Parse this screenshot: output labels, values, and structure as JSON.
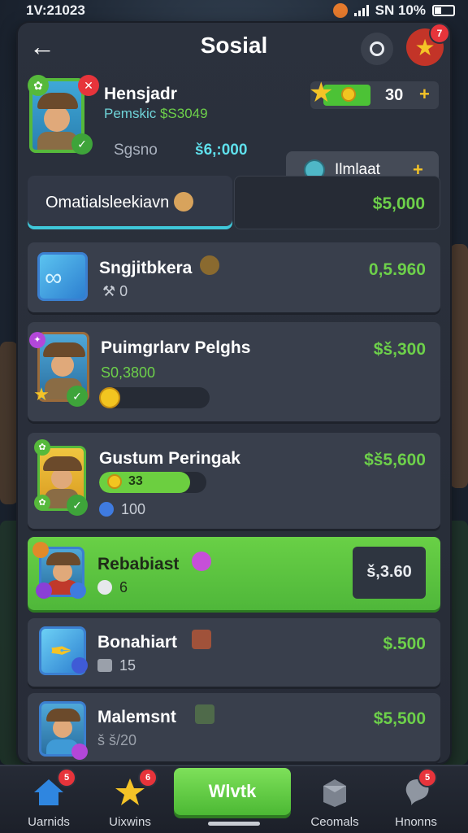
{
  "status_bar": {
    "time": "1V:21023",
    "right_text": "SN 10%"
  },
  "header": {
    "title": "Sosial",
    "notification_count": "7"
  },
  "profile": {
    "name": "Hensjadr",
    "subtitle_prefix": "Pemskic",
    "subtitle_money": "$S3049",
    "stat_label": "Sgsno",
    "cash": "š6,:000"
  },
  "counter": {
    "value": "30"
  },
  "invite": {
    "label": "Ilmlaat"
  },
  "tabs": {
    "active_label": "Omatialsleekiavn",
    "total_value": "$5,000"
  },
  "rows": [
    {
      "name": "Sngjitbkera",
      "value": "0,5.960",
      "sub": "0"
    },
    {
      "name": "Puimgrlarv Pelghs",
      "value": "$š,300",
      "sub_money": "S0,3800",
      "progress": 0
    },
    {
      "name": "Gustum Peringak",
      "value": "$š5,600",
      "progress_label": "33",
      "progress": 0.85,
      "sub": "100"
    },
    {
      "name": "Rebabiast",
      "value": "š,3.60",
      "sub": "6"
    },
    {
      "name": "Bonahiart",
      "value": "$.500",
      "sub": "15"
    },
    {
      "name": "Malemsnt",
      "value": "$5,500",
      "sub": "š š/20"
    }
  ],
  "nav": {
    "items": [
      {
        "label": "Uarnids",
        "badge": "5"
      },
      {
        "label": "Uixwins",
        "badge": "6"
      },
      {
        "label": "Ceomals"
      },
      {
        "label": "Hnonns",
        "badge": "5"
      }
    ],
    "center_label": "Wlvtk"
  },
  "colors": {
    "accent_green": "#6dd04a",
    "accent_cyan": "#5fe0ec",
    "badge_red": "#e7343b",
    "gold": "#f4c327"
  }
}
